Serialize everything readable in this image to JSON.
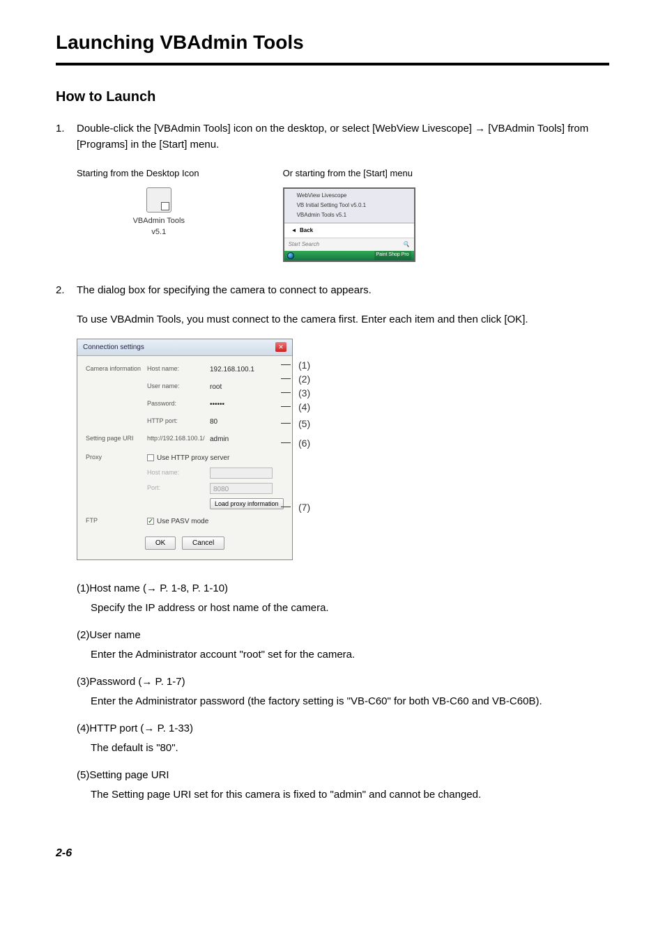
{
  "page_title": "Launching VBAdmin Tools",
  "section_title": "How to Launch",
  "step1_num": "1.",
  "step1_text": "Double-click the [VBAdmin Tools] icon on the desktop, or select [WebView Livescope] → [VBAdmin Tools] from [Programs] in the [Start] menu.",
  "icon_caption_left": "Starting from the Desktop Icon",
  "icon_caption_right": "Or starting from the [Start] menu",
  "desktop_icon_label1": "VBAdmin Tools",
  "desktop_icon_label2": "v5.1",
  "start_menu": {
    "folder": "WebView Livescope",
    "item1": "VB Initial Setting Tool v5.0.1",
    "item2": "VBAdmin Tools v5.1",
    "back": "Back",
    "search": "Start Search",
    "taskbar_right": "Paint Shop Pro"
  },
  "step2_num": "2.",
  "step2_text": "The dialog box for specifying the camera to connect to appears.",
  "step2_sub": "To use VBAdmin Tools, you must connect to the camera first. Enter each item and then click [OK].",
  "dialog": {
    "title": "Connection settings",
    "section_camera": "Camera information",
    "host_label": "Host name:",
    "host_value": "192.168.100.1",
    "user_label": "User name:",
    "user_value": "root",
    "pass_label": "Password:",
    "pass_value": "••••••",
    "port_label": "HTTP port:",
    "port_value": "80",
    "section_uri": "Setting page URI",
    "uri_prefix": "http://192.168.100.1/",
    "uri_value": "admin",
    "section_proxy": "Proxy",
    "proxy_check_label": "Use HTTP proxy server",
    "proxy_host_label": "Host name:",
    "proxy_port_label": "Port:",
    "proxy_port_value": "8080",
    "load_proxy_btn": "Load proxy information",
    "section_ftp": "FTP",
    "ftp_check_label": "Use PASV mode",
    "ok_btn": "OK",
    "cancel_btn": "Cancel"
  },
  "callouts": {
    "c1": "(1)",
    "c2": "(2)",
    "c3": "(3)",
    "c4": "(4)",
    "c5": "(5)",
    "c6": "(6)",
    "c7": "(7)"
  },
  "defs": {
    "d1_head": "(1)Host name (→ P. 1-8, P. 1-10)",
    "d1_body": "Specify the IP address or host name of the camera.",
    "d2_head": "(2)User name",
    "d2_body": "Enter the Administrator account \"root\" set for the camera.",
    "d3_head": "(3)Password (→ P. 1-7)",
    "d3_body": "Enter the Administrator password (the factory setting is \"VB-C60\" for both VB-C60 and VB-C60B).",
    "d4_head": "(4)HTTP port (→ P. 1-33)",
    "d4_body": "The default is \"80\".",
    "d5_head": "(5)Setting page URI",
    "d5_body": "The Setting page URI set for this camera is fixed to \"admin\" and cannot be changed."
  },
  "page_number": "2-6"
}
